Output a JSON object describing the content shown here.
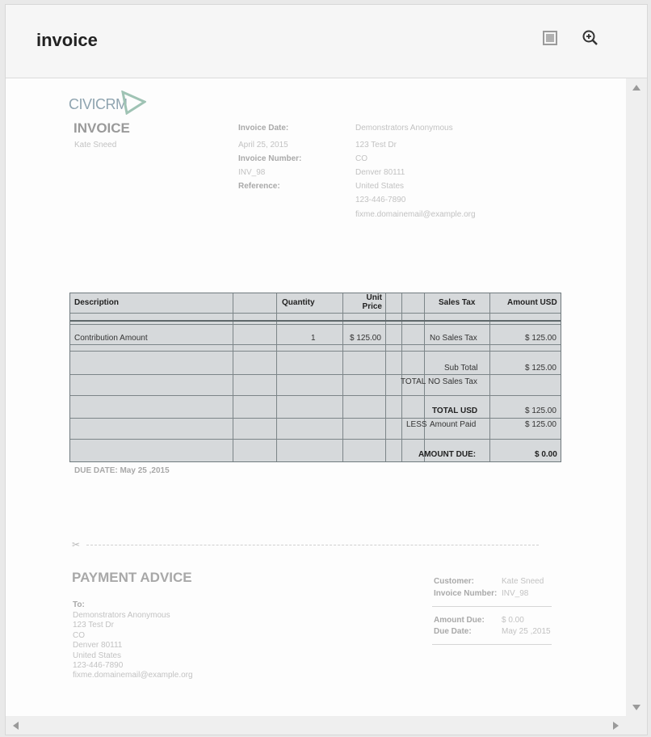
{
  "window": {
    "title": "invoice"
  },
  "toolbar": {
    "fit_icon": "fit-page-icon",
    "zoom_icon": "zoom-in-icon"
  },
  "invoice": {
    "logo_text": "CIVICRM",
    "heading": "INVOICE",
    "contact_name": "Kate Sneed",
    "meta": {
      "invoice_date_label": "Invoice Date:",
      "invoice_date": "April 25, 2015",
      "invoice_number_label": "Invoice Number:",
      "invoice_number": "INV_98",
      "reference_label": "Reference:"
    },
    "org": {
      "name": "Demonstrators Anonymous",
      "street": "123 Test Dr",
      "state": "CO",
      "city_zip": "Denver 80111",
      "country": "United States",
      "phone": "123-446-7890",
      "email": "fixme.domainemail@example.org"
    },
    "table": {
      "headers": {
        "description": "Description",
        "quantity": "Quantity",
        "unit_price": "Unit Price",
        "sales_tax": "Sales Tax",
        "amount": "Amount USD"
      },
      "row": {
        "description": "Contribution Amount",
        "quantity": "1",
        "unit_price": "$ 125.00",
        "sales_tax": "No Sales Tax",
        "amount": "$ 125.00"
      },
      "sub_total_label": "Sub Total",
      "sub_total": "$ 125.00",
      "total_no_tax_prefix": "TOTAL",
      "total_no_tax_label": "NO Sales Tax",
      "total_usd_label": "TOTAL USD",
      "total_usd": "$ 125.00",
      "less_prefix": "LESS",
      "amount_paid_label": "Amount Paid",
      "amount_paid": "$ 125.00",
      "amount_due_label": "AMOUNT DUE:",
      "amount_due": "$ 0.00"
    },
    "due_date_text": "DUE DATE: May 25 ,2015",
    "cut_icon": "scissors-icon",
    "payment_advice": {
      "heading": "PAYMENT ADVICE",
      "to_label": "To:",
      "to_name": "Demonstrators Anonymous",
      "to_street": "123 Test Dr",
      "to_state": "CO",
      "to_city_zip": "Denver 80111",
      "to_country": "United States",
      "to_phone": "123-446-7890",
      "to_email": "fixme.domainemail@example.org",
      "customer_label": "Customer:",
      "customer": "Kate Sneed",
      "invoice_number_label": "Invoice Number:",
      "invoice_number": "INV_98",
      "amount_due_label": "Amount Due:",
      "amount_due": "$ 0.00",
      "due_date_label": "Due Date:",
      "due_date": "May 25 ,2015"
    }
  }
}
